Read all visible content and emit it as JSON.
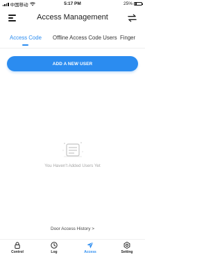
{
  "status_bar": {
    "carrier": "中国移动",
    "time": "5:17 PM",
    "battery_percent": "25%",
    "battery_level": 0.25
  },
  "header": {
    "title": "Access Management",
    "menu_icon": "hamburger-menu-icon",
    "swap_icon": "swap-arrows-icon"
  },
  "tabs": [
    {
      "label": "Access Code",
      "active": true
    },
    {
      "label": "Offline Access Code Users",
      "active": false
    },
    {
      "label": "Finger",
      "active": false
    }
  ],
  "actions": {
    "add_user_label": "ADD A NEW USER"
  },
  "empty_state": {
    "icon": "document-list-icon",
    "message": "You Haven't Added Users Yet"
  },
  "history_link": "Door Access History >",
  "bottom_nav": [
    {
      "label": "Control",
      "icon": "lock-icon",
      "active": false
    },
    {
      "label": "Log",
      "icon": "clock-icon",
      "active": false
    },
    {
      "label": "Access",
      "icon": "send-icon",
      "active": true
    },
    {
      "label": "Setting",
      "icon": "gear-icon",
      "active": false
    }
  ],
  "colors": {
    "accent": "#2b8cf0",
    "muted_text": "#a6a6a6"
  }
}
